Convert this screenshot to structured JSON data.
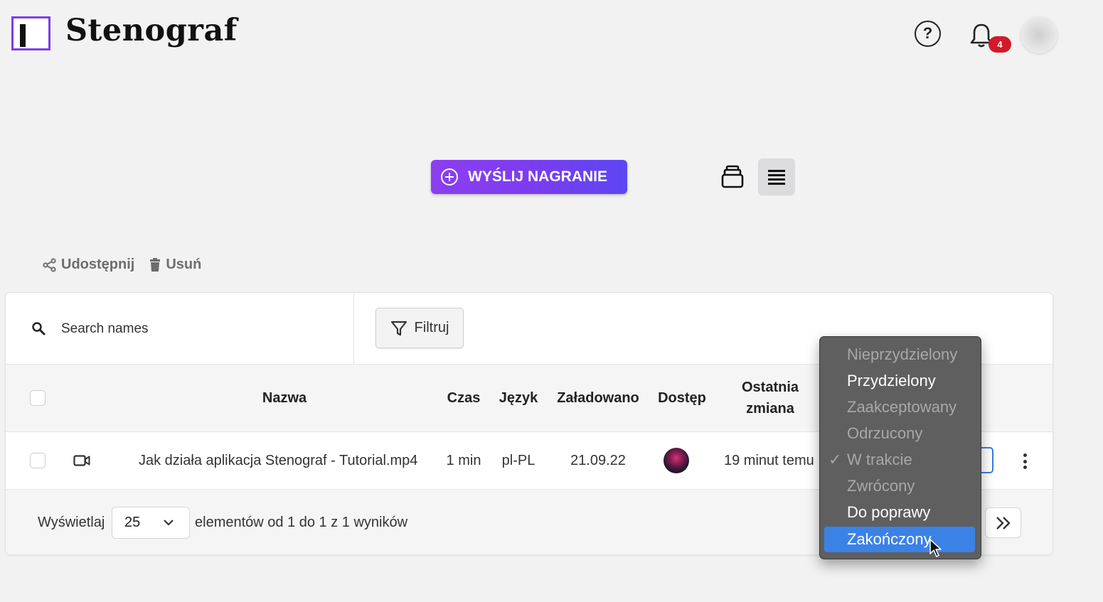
{
  "brand": {
    "name": "Stenograf"
  },
  "header": {
    "help_label": "?",
    "notifications_count": "4"
  },
  "toolbar": {
    "upload_label": "WYŚLIJ NAGRANIE"
  },
  "actions": {
    "share_label": "Udostępnij",
    "delete_label": "Usuń"
  },
  "search": {
    "placeholder": "Search names"
  },
  "filter": {
    "label": "Filtruj"
  },
  "table": {
    "headers": {
      "name": "Nazwa",
      "duration": "Czas",
      "language": "Język",
      "uploaded": "Załadowano",
      "access": "Dostęp",
      "last_change_1": "Ostatnia",
      "last_change_2": "zmiana"
    },
    "rows": [
      {
        "name": "Jak działa aplikacja Stenograf - Tutorial.mp4",
        "duration": "1 min",
        "language": "pl-PL",
        "uploaded": "21.09.22",
        "last_change": "19 minut temu"
      }
    ]
  },
  "pagination": {
    "show_label": "Wyświetlaj",
    "per_page": "25",
    "summary": "elementów od 1 do 1 z 1 wyników",
    "next_label": "»"
  },
  "status_menu": {
    "items": [
      {
        "label": "Nieprzydzielony",
        "enabled": false
      },
      {
        "label": "Przydzielony",
        "enabled": true
      },
      {
        "label": "Zaakceptowany",
        "enabled": false
      },
      {
        "label": "Odrzucony",
        "enabled": false
      },
      {
        "label": "W trakcie",
        "enabled": false,
        "checked": true
      },
      {
        "label": "Zwrócony",
        "enabled": false
      },
      {
        "label": "Do poprawy",
        "enabled": true
      },
      {
        "label": "Zakończony",
        "enabled": true,
        "highlighted": true
      }
    ]
  },
  "colors": {
    "accent": "#7c3cf0",
    "highlight": "#3b82e6",
    "badge": "#d11a2a"
  }
}
